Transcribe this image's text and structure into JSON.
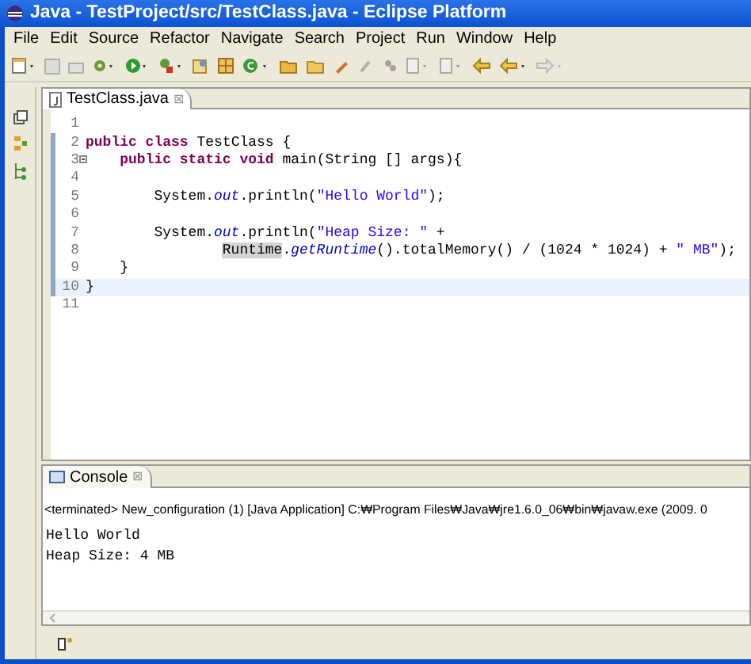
{
  "window": {
    "title": "Java - TestProject/src/TestClass.java - Eclipse Platform"
  },
  "menu": [
    "File",
    "Edit",
    "Source",
    "Refactor",
    "Navigate",
    "Search",
    "Project",
    "Run",
    "Window",
    "Help"
  ],
  "editor": {
    "tab": {
      "label": "TestClass.java",
      "close": "⊠"
    },
    "lines": [
      {
        "number": "1",
        "current": false,
        "changed": false,
        "fold": false
      },
      {
        "number": "2",
        "current": false,
        "changed": true,
        "fold": false,
        "tokens": [
          {
            "kind": "keyword",
            "text": "public class"
          },
          {
            "kind": "plain",
            "text": " TestClass {"
          }
        ],
        "children": [
          {
            "number": "3",
            "current": false,
            "changed": true,
            "fold": true,
            "tokens": [
              {
                "kind": "keyword",
                "text": "public static void"
              },
              {
                "kind": "plain",
                "text": " main(String [] args){"
              }
            ],
            "children": [
              {
                "number": "4",
                "current": false,
                "changed": true,
                "fold": false
              },
              {
                "number": "5",
                "current": false,
                "changed": true,
                "fold": false,
                "tokens": [
                  {
                    "kind": "plain",
                    "text": "System."
                  },
                  {
                    "kind": "field",
                    "text": "out"
                  },
                  {
                    "kind": "plain",
                    "text": ".println("
                  },
                  {
                    "kind": "string",
                    "text": "\"Hello World\""
                  },
                  {
                    "kind": "plain",
                    "text": ");"
                  }
                ]
              },
              {
                "number": "6",
                "current": false,
                "changed": true,
                "fold": false
              },
              {
                "number": "7",
                "current": false,
                "changed": true,
                "fold": false,
                "tokens": [
                  {
                    "kind": "plain",
                    "text": "System."
                  },
                  {
                    "kind": "field",
                    "text": "out"
                  },
                  {
                    "kind": "plain",
                    "text": ".println("
                  },
                  {
                    "kind": "string",
                    "text": "\"Heap Size: \""
                  },
                  {
                    "kind": "plain",
                    "text": " +"
                  }
                ],
                "children": [
                  {
                    "number": "8",
                    "current": false,
                    "changed": true,
                    "fold": false,
                    "kind": "continuation",
                    "tokens": [
                      {
                        "kind": "occurrence",
                        "text": "Runtime"
                      },
                      {
                        "kind": "plain",
                        "text": "."
                      },
                      {
                        "kind": "field",
                        "text": "getRuntime"
                      },
                      {
                        "kind": "plain",
                        "text": "().totalMemory() / (1024 * 1024) + "
                      },
                      {
                        "kind": "string",
                        "text": "\" MB\""
                      },
                      {
                        "kind": "plain",
                        "text": ");"
                      }
                    ]
                  }
                ]
              }
            ]
          },
          {
            "number": "9",
            "current": false,
            "changed": true,
            "fold": false,
            "tokens": [
              {
                "kind": "plain",
                "text": "}"
              }
            ]
          }
        ]
      },
      {
        "number": "10",
        "current": true,
        "changed": true,
        "fold": false,
        "tokens": [
          {
            "kind": "plain",
            "text": "}"
          }
        ]
      },
      {
        "number": "11",
        "current": false,
        "changed": false,
        "fold": false
      }
    ]
  },
  "console": {
    "tab": {
      "label": "Console",
      "close": "⊠"
    },
    "header": "<terminated> New_configuration (1) [Java Application] C:₩Program Files₩Java₩jre1.6.0_06₩bin₩javaw.exe (2009. 0",
    "output": [
      "Hello World",
      "Heap Size: 4 MB"
    ]
  }
}
